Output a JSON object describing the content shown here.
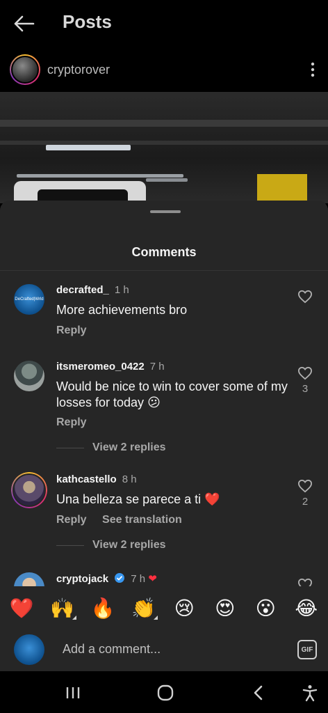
{
  "header": {
    "title": "Posts"
  },
  "post": {
    "username": "cryptorover"
  },
  "sheet": {
    "title": "Comments",
    "comments": [
      {
        "user": "decrafted_",
        "time": "1 h",
        "text": "More achievements bro",
        "reply": "Reply"
      },
      {
        "user": "itsmeromeo_0422",
        "time": "7 h",
        "text": "Would be nice to win to cover some of my losses for today 😕",
        "reply": "Reply",
        "likes": "3",
        "view_replies": "View 2 replies"
      },
      {
        "user": "kathcastello",
        "time": "8 h",
        "text": "Una belleza se parece a ti ❤️",
        "reply": "Reply",
        "see_translation": "See translation",
        "likes": "2",
        "view_replies": "View 2 replies"
      },
      {
        "user": "cryptojack",
        "time": "7 h"
      }
    ],
    "avatar_decrafted_text": "DeCrafted|Wrld",
    "emojis": [
      "❤️",
      "🙌",
      "🔥",
      "👏",
      "😢",
      "😍",
      "😮",
      "😂"
    ],
    "input": {
      "placeholder": "Add a comment...",
      "gif_label": "GIF"
    }
  },
  "colors": {
    "sheet_bg": "#262626",
    "heart_red": "#ff3040",
    "verified_blue": "#3897f0"
  }
}
